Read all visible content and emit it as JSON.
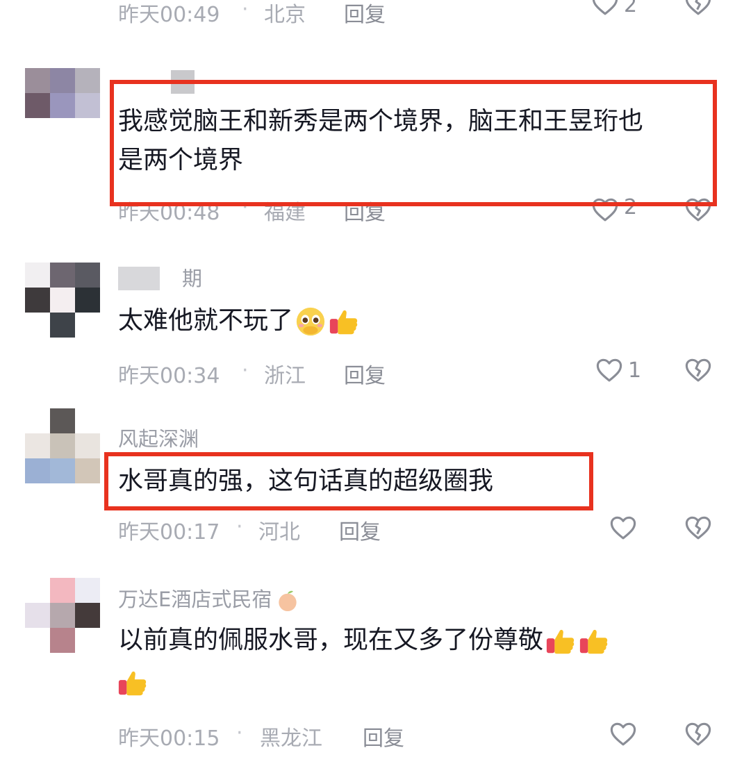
{
  "comments": [
    {
      "name": "",
      "text_lines": [],
      "time": "昨天00:49",
      "location": "北京",
      "reply_label": "回复",
      "like_count": "2"
    },
    {
      "name": "",
      "text_lines": [
        "我感觉脑王和新秀是两个境界，脑王和王昱珩也",
        "是两个境界"
      ],
      "time": "昨天00:48",
      "location": "福建",
      "reply_label": "回复",
      "like_count": "2",
      "highlighted": true
    },
    {
      "name": "期",
      "text_lines": [
        "太难他就不玩了"
      ],
      "emojis": [
        "pleading-face-icon",
        "thumbs-up-icon"
      ],
      "time": "昨天00:34",
      "location": "浙江",
      "reply_label": "回复",
      "like_count": "1"
    },
    {
      "name": "风起深渊",
      "text_lines": [
        "水哥真的强，这句话真的超级圈我"
      ],
      "time": "昨天00:17",
      "location": "河北",
      "reply_label": "回复",
      "like_count": "",
      "highlighted": true
    },
    {
      "name": "万达E酒店式民宿",
      "name_emoji": "peach-icon",
      "text_lines": [
        "以前真的佩服水哥，现在又多了份尊敬"
      ],
      "emojis": [
        "thumbs-up-icon",
        "thumbs-up-icon",
        "thumbs-up-icon"
      ],
      "time": "昨天00:15",
      "location": "黑龙江",
      "reply_label": "回复",
      "like_count": ""
    }
  ],
  "separator": "·",
  "colors": {
    "highlight": "#e8321f",
    "meta": "#a8abb3",
    "text": "#161823"
  }
}
